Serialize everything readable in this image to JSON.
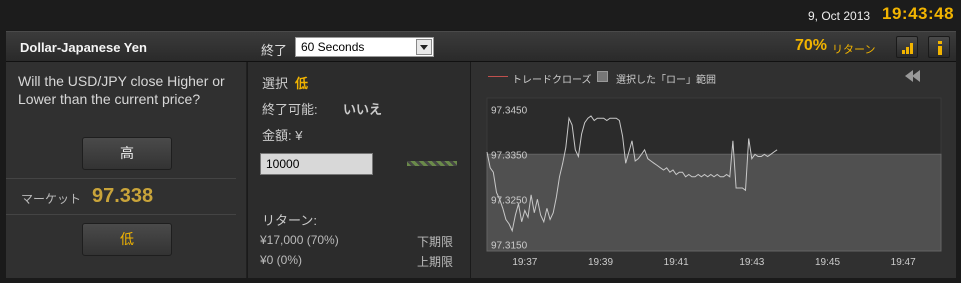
{
  "topbar": {
    "date": "9, Oct 2013",
    "time": "19:43:48"
  },
  "header": {
    "asset": "Dollar-Japanese Yen",
    "expiry_label": "終了",
    "expiry_value": "60 Seconds",
    "payout": "70%",
    "payout_label": "リターン",
    "icons": [
      "signal-bars-icon",
      "info-icon"
    ],
    "accent_color": "#f2b400"
  },
  "left": {
    "question": "Will the USD/JPY close Higher or Lower than the current price?",
    "high_button": "高",
    "market_label": "マーケット",
    "market_value": "97.338",
    "low_button": "低"
  },
  "middle": {
    "selection_label": "選択",
    "selection_value": "低",
    "early_close_label": "終了可能:",
    "early_close_value": "いいえ",
    "amount_label": "金額: ¥",
    "amount_value": "10000",
    "return_label": "リターン:",
    "return_lower_value": "¥17,000 (70%)",
    "return_lower_label": "下期限",
    "return_upper_value": "¥0 (0%)",
    "return_upper_label": "上期限"
  },
  "chart": {
    "legend_line": "トレードクローズ",
    "legend_range": "選択した「ロー」範囲",
    "icons": [
      "rewind-icon"
    ]
  },
  "chart_data": {
    "type": "line",
    "title": "",
    "xlabel": "",
    "ylabel": "",
    "x_ticks": [
      "19:37",
      "19:39",
      "19:41",
      "19:43",
      "19:45",
      "19:47"
    ],
    "y_ticks": [
      "97.3450",
      "97.3350",
      "97.3250",
      "97.3150"
    ],
    "ylim": [
      97.3135,
      97.3475
    ],
    "grid": false,
    "highlight_band": {
      "label": "選択した「ロー」範囲",
      "y_from": 97.3135,
      "y_to": 97.335
    },
    "series": [
      {
        "name": "",
        "x": [
          "19:36:00",
          "19:36:05",
          "19:36:10",
          "19:36:15",
          "19:36:20",
          "19:36:25",
          "19:36:30",
          "19:36:35",
          "19:36:40",
          "19:36:45",
          "19:36:50",
          "19:36:55",
          "19:37:00",
          "19:37:05",
          "19:37:10",
          "19:37:15",
          "19:37:20",
          "19:37:25",
          "19:37:30",
          "19:37:35",
          "19:37:40",
          "19:37:45",
          "19:37:50",
          "19:37:55",
          "19:38:00",
          "19:38:05",
          "19:38:10",
          "19:38:15",
          "19:38:20",
          "19:38:25",
          "19:38:30",
          "19:38:35",
          "19:38:40",
          "19:38:45",
          "19:38:50",
          "19:38:55",
          "19:39:00",
          "19:39:05",
          "19:39:10",
          "19:39:15",
          "19:39:20",
          "19:39:25",
          "19:39:30",
          "19:39:35",
          "19:39:40",
          "19:39:45",
          "19:39:50",
          "19:39:55",
          "19:40:00",
          "19:40:05",
          "19:40:10",
          "19:40:15",
          "19:40:20",
          "19:40:25",
          "19:40:30",
          "19:40:35",
          "19:40:40",
          "19:40:45",
          "19:40:50",
          "19:40:55",
          "19:41:00",
          "19:41:05",
          "19:41:10",
          "19:41:15",
          "19:41:20",
          "19:41:25",
          "19:41:30",
          "19:41:35",
          "19:41:40",
          "19:41:45",
          "19:41:50",
          "19:41:55",
          "19:42:00",
          "19:42:05",
          "19:42:10",
          "19:42:15",
          "19:42:20",
          "19:42:25",
          "19:42:30",
          "19:42:35",
          "19:42:40",
          "19:42:45",
          "19:42:50",
          "19:42:55",
          "19:43:00",
          "19:43:05",
          "19:43:10",
          "19:43:15",
          "19:43:20",
          "19:43:25",
          "19:43:30",
          "19:43:35",
          "19:43:40"
        ],
        "values": [
          97.3355,
          97.332,
          97.331,
          97.3265,
          97.325,
          97.323,
          97.3205,
          97.3195,
          97.318,
          97.3215,
          97.324,
          97.32,
          97.3225,
          97.321,
          97.326,
          97.322,
          97.325,
          97.3215,
          97.32,
          97.323,
          97.3205,
          97.322,
          97.3255,
          97.33,
          97.333,
          97.3365,
          97.343,
          97.3415,
          97.336,
          97.3345,
          97.3395,
          97.342,
          97.343,
          97.3435,
          97.3425,
          97.343,
          97.343,
          97.343,
          97.3425,
          97.343,
          97.343,
          97.343,
          97.3425,
          97.339,
          97.333,
          97.3355,
          97.338,
          97.3335,
          97.334,
          97.335,
          97.336,
          97.334,
          97.3335,
          97.333,
          97.3325,
          97.332,
          97.3315,
          97.332,
          97.331,
          97.3315,
          97.3305,
          97.331,
          97.331,
          97.33,
          97.3305,
          97.33,
          97.33,
          97.3305,
          97.33,
          97.3305,
          97.33,
          97.3305,
          97.33,
          97.3305,
          97.33,
          97.33,
          97.3305,
          97.33,
          97.338,
          97.3275,
          97.3275,
          97.3275,
          97.327,
          97.3385,
          97.334,
          97.335,
          97.3345,
          97.3345,
          97.335,
          97.3345,
          97.335,
          97.3355,
          97.336
        ]
      }
    ]
  }
}
